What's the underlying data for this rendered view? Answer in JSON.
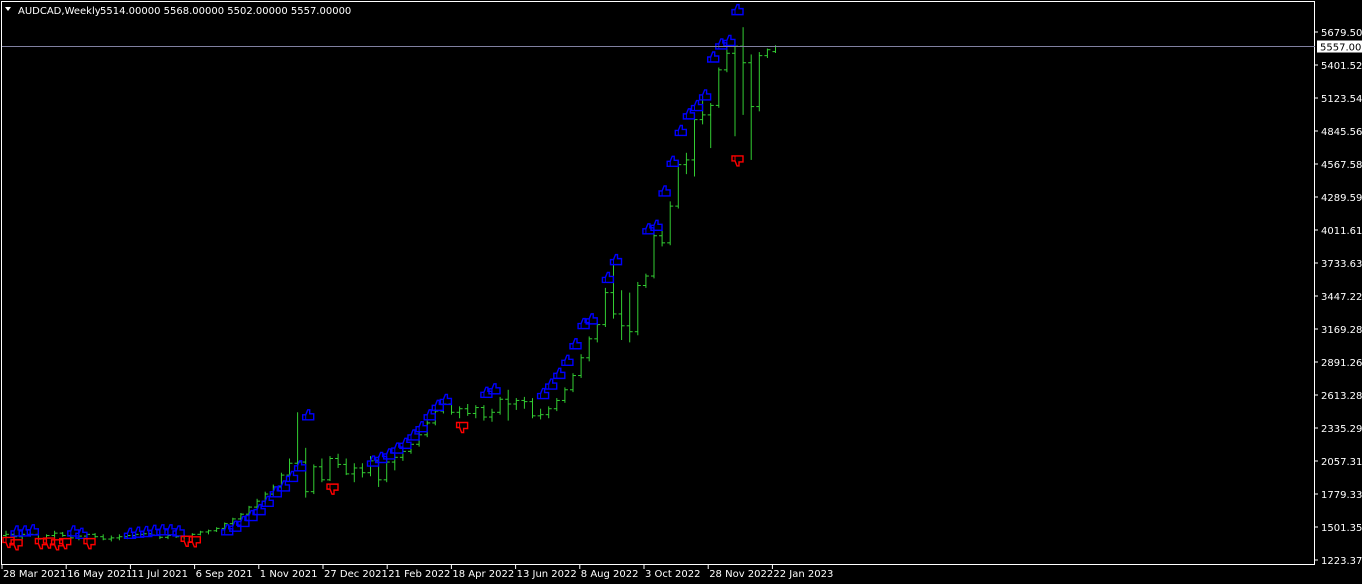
{
  "header": {
    "symbol_label": "AUDCAD,Weekly",
    "ohlc": "5514.00000 5568.00000 5502.00000 5557.00000"
  },
  "colors": {
    "background": "#000000",
    "bars": "#32CD32",
    "frame": "#ffffff",
    "bid_line": "#8080a0",
    "up_signal": "#0000ff",
    "down_signal": "#ff0000",
    "text": "#ffffff"
  },
  "chart_data": {
    "type": "ohlc-bar",
    "title": "AUDCAD,Weekly",
    "timeframe": "Weekly",
    "current_price": 5557.0,
    "current_price_label": "5557.0000",
    "ylim": [
      1223.3713,
      5679.5084
    ],
    "y_ticks": [
      "5679.5084",
      "5401.5263",
      "5123.5442",
      "4845.5621",
      "4567.5800",
      "4289.5979",
      "4011.6158",
      "3733.6337",
      "3447.2279",
      "3169.2816",
      "2891.2637",
      "2613.2816",
      "2335.2995",
      "2057.3174",
      "1779.3353",
      "1501.3532",
      "1223.3713"
    ],
    "x_ticks": [
      "28 Mar 2021",
      "16 May 2021",
      "11 Jul 2021",
      "6 Sep 2021",
      "1 Nov 2021",
      "27 Dec 2021",
      "21 Feb 2022",
      "18 Apr 2022",
      "13 Jun 2022",
      "8 Aug 2022",
      "3 Oct 2022",
      "28 Nov 2022",
      "22 Jan 2023"
    ],
    "bars": [
      {
        "o": 1430,
        "h": 1470,
        "l": 1395,
        "c": 1440
      },
      {
        "o": 1440,
        "h": 1450,
        "l": 1390,
        "c": 1420
      },
      {
        "o": 1420,
        "h": 1460,
        "l": 1400,
        "c": 1440
      },
      {
        "o": 1440,
        "h": 1460,
        "l": 1420,
        "c": 1440
      },
      {
        "o": 1440,
        "h": 1450,
        "l": 1390,
        "c": 1400
      },
      {
        "o": 1400,
        "h": 1440,
        "l": 1390,
        "c": 1430
      },
      {
        "o": 1430,
        "h": 1470,
        "l": 1410,
        "c": 1450
      },
      {
        "o": 1450,
        "h": 1460,
        "l": 1420,
        "c": 1430
      },
      {
        "o": 1430,
        "h": 1440,
        "l": 1395,
        "c": 1410
      },
      {
        "o": 1410,
        "h": 1440,
        "l": 1390,
        "c": 1425
      },
      {
        "o": 1425,
        "h": 1450,
        "l": 1410,
        "c": 1440
      },
      {
        "o": 1440,
        "h": 1450,
        "l": 1410,
        "c": 1420
      },
      {
        "o": 1420,
        "h": 1440,
        "l": 1390,
        "c": 1400
      },
      {
        "o": 1400,
        "h": 1430,
        "l": 1380,
        "c": 1410
      },
      {
        "o": 1410,
        "h": 1440,
        "l": 1390,
        "c": 1420
      },
      {
        "o": 1420,
        "h": 1450,
        "l": 1400,
        "c": 1430
      },
      {
        "o": 1430,
        "h": 1450,
        "l": 1410,
        "c": 1440
      },
      {
        "o": 1440,
        "h": 1460,
        "l": 1420,
        "c": 1445
      },
      {
        "o": 1445,
        "h": 1460,
        "l": 1420,
        "c": 1435
      },
      {
        "o": 1435,
        "h": 1450,
        "l": 1400,
        "c": 1415
      },
      {
        "o": 1415,
        "h": 1445,
        "l": 1400,
        "c": 1430
      },
      {
        "o": 1430,
        "h": 1450,
        "l": 1410,
        "c": 1420
      },
      {
        "o": 1420,
        "h": 1440,
        "l": 1400,
        "c": 1425
      },
      {
        "o": 1425,
        "h": 1450,
        "l": 1410,
        "c": 1440
      },
      {
        "o": 1440,
        "h": 1470,
        "l": 1430,
        "c": 1460
      },
      {
        "o": 1460,
        "h": 1480,
        "l": 1440,
        "c": 1470
      },
      {
        "o": 1470,
        "h": 1500,
        "l": 1460,
        "c": 1490
      },
      {
        "o": 1490,
        "h": 1540,
        "l": 1480,
        "c": 1530
      },
      {
        "o": 1530,
        "h": 1580,
        "l": 1510,
        "c": 1570
      },
      {
        "o": 1570,
        "h": 1620,
        "l": 1550,
        "c": 1610
      },
      {
        "o": 1610,
        "h": 1680,
        "l": 1590,
        "c": 1670
      },
      {
        "o": 1670,
        "h": 1740,
        "l": 1650,
        "c": 1720
      },
      {
        "o": 1720,
        "h": 1800,
        "l": 1700,
        "c": 1780
      },
      {
        "o": 1780,
        "h": 1860,
        "l": 1760,
        "c": 1840
      },
      {
        "o": 1840,
        "h": 1960,
        "l": 1820,
        "c": 1940
      },
      {
        "o": 1940,
        "h": 2080,
        "l": 1920,
        "c": 2040
      },
      {
        "o": 2040,
        "h": 2470,
        "l": 1990,
        "c": 2050
      },
      {
        "o": 2050,
        "h": 2170,
        "l": 1750,
        "c": 1800
      },
      {
        "o": 1800,
        "h": 2030,
        "l": 1780,
        "c": 2010
      },
      {
        "o": 2010,
        "h": 2080,
        "l": 1880,
        "c": 1900
      },
      {
        "o": 1900,
        "h": 2100,
        "l": 1890,
        "c": 2080
      },
      {
        "o": 2080,
        "h": 2120,
        "l": 2000,
        "c": 2030
      },
      {
        "o": 2030,
        "h": 2080,
        "l": 1940,
        "c": 1950
      },
      {
        "o": 1950,
        "h": 2040,
        "l": 1880,
        "c": 2000
      },
      {
        "o": 2000,
        "h": 2040,
        "l": 1920,
        "c": 1960
      },
      {
        "o": 1960,
        "h": 2100,
        "l": 1930,
        "c": 2060
      },
      {
        "o": 2060,
        "h": 2100,
        "l": 1840,
        "c": 1900
      },
      {
        "o": 1900,
        "h": 2080,
        "l": 1880,
        "c": 2050
      },
      {
        "o": 2050,
        "h": 2110,
        "l": 1980,
        "c": 2090
      },
      {
        "o": 2090,
        "h": 2160,
        "l": 2060,
        "c": 2140
      },
      {
        "o": 2140,
        "h": 2220,
        "l": 2120,
        "c": 2200
      },
      {
        "o": 2200,
        "h": 2300,
        "l": 2180,
        "c": 2280
      },
      {
        "o": 2280,
        "h": 2400,
        "l": 2260,
        "c": 2380
      },
      {
        "o": 2380,
        "h": 2500,
        "l": 2360,
        "c": 2480
      },
      {
        "o": 2480,
        "h": 2570,
        "l": 2460,
        "c": 2540
      },
      {
        "o": 2540,
        "h": 2560,
        "l": 2450,
        "c": 2470
      },
      {
        "o": 2470,
        "h": 2520,
        "l": 2420,
        "c": 2500
      },
      {
        "o": 2500,
        "h": 2540,
        "l": 2440,
        "c": 2460
      },
      {
        "o": 2460,
        "h": 2530,
        "l": 2420,
        "c": 2510
      },
      {
        "o": 2510,
        "h": 2530,
        "l": 2400,
        "c": 2430
      },
      {
        "o": 2430,
        "h": 2500,
        "l": 2390,
        "c": 2470
      },
      {
        "o": 2470,
        "h": 2600,
        "l": 2450,
        "c": 2580
      },
      {
        "o": 2580,
        "h": 2660,
        "l": 2400,
        "c": 2540
      },
      {
        "o": 2540,
        "h": 2590,
        "l": 2490,
        "c": 2570
      },
      {
        "o": 2570,
        "h": 2600,
        "l": 2500,
        "c": 2560
      },
      {
        "o": 2560,
        "h": 2590,
        "l": 2420,
        "c": 2440
      },
      {
        "o": 2440,
        "h": 2500,
        "l": 2410,
        "c": 2450
      },
      {
        "o": 2450,
        "h": 2520,
        "l": 2420,
        "c": 2500
      },
      {
        "o": 2500,
        "h": 2590,
        "l": 2480,
        "c": 2570
      },
      {
        "o": 2570,
        "h": 2680,
        "l": 2550,
        "c": 2660
      },
      {
        "o": 2660,
        "h": 2800,
        "l": 2640,
        "c": 2780
      },
      {
        "o": 2780,
        "h": 2960,
        "l": 2760,
        "c": 2930
      },
      {
        "o": 2930,
        "h": 3110,
        "l": 2900,
        "c": 3090
      },
      {
        "o": 3090,
        "h": 3230,
        "l": 3060,
        "c": 3210
      },
      {
        "o": 3210,
        "h": 3520,
        "l": 3190,
        "c": 3480
      },
      {
        "o": 3480,
        "h": 3720,
        "l": 3260,
        "c": 3300
      },
      {
        "o": 3300,
        "h": 3500,
        "l": 3080,
        "c": 3200
      },
      {
        "o": 3200,
        "h": 3480,
        "l": 3060,
        "c": 3150
      },
      {
        "o": 3150,
        "h": 3570,
        "l": 3120,
        "c": 3540
      },
      {
        "o": 3540,
        "h": 3640,
        "l": 3520,
        "c": 3620
      },
      {
        "o": 3620,
        "h": 4000,
        "l": 3600,
        "c": 3960
      },
      {
        "o": 3960,
        "h": 4000,
        "l": 3870,
        "c": 3900
      },
      {
        "o": 3900,
        "h": 4250,
        "l": 3880,
        "c": 4210
      },
      {
        "o": 4210,
        "h": 4590,
        "l": 4190,
        "c": 4560
      },
      {
        "o": 4560,
        "h": 4660,
        "l": 4480,
        "c": 4600
      },
      {
        "o": 4600,
        "h": 4960,
        "l": 4460,
        "c": 4940
      },
      {
        "o": 4940,
        "h": 5140,
        "l": 4900,
        "c": 4980
      },
      {
        "o": 4980,
        "h": 5080,
        "l": 4700,
        "c": 5060
      },
      {
        "o": 5060,
        "h": 5380,
        "l": 5040,
        "c": 5360
      },
      {
        "o": 5360,
        "h": 5560,
        "l": 5340,
        "c": 5500
      },
      {
        "o": 5500,
        "h": 5580,
        "l": 4800,
        "c": 5560
      },
      {
        "o": 5560,
        "h": 5720,
        "l": 4980,
        "c": 5420
      },
      {
        "o": 5420,
        "h": 5490,
        "l": 4600,
        "c": 5050
      },
      {
        "o": 5050,
        "h": 5510,
        "l": 5010,
        "c": 5480
      },
      {
        "o": 5480,
        "h": 5540,
        "l": 5460,
        "c": 5530
      },
      {
        "o": 5514,
        "h": 5568,
        "l": 5502,
        "c": 5557
      }
    ],
    "up_signals": [
      {
        "i": 1,
        "v": 1460
      },
      {
        "i": 2,
        "v": 1460
      },
      {
        "i": 3,
        "v": 1470
      },
      {
        "i": 8,
        "v": 1460
      },
      {
        "i": 9,
        "v": 1440
      },
      {
        "i": 15,
        "v": 1440
      },
      {
        "i": 16,
        "v": 1450
      },
      {
        "i": 17,
        "v": 1455
      },
      {
        "i": 18,
        "v": 1465
      },
      {
        "i": 19,
        "v": 1470
      },
      {
        "i": 20,
        "v": 1470
      },
      {
        "i": 21,
        "v": 1460
      },
      {
        "i": 27,
        "v": 1470
      },
      {
        "i": 28,
        "v": 1500
      },
      {
        "i": 29,
        "v": 1540
      },
      {
        "i": 30,
        "v": 1590
      },
      {
        "i": 31,
        "v": 1640
      },
      {
        "i": 32,
        "v": 1710
      },
      {
        "i": 33,
        "v": 1790
      },
      {
        "i": 34,
        "v": 1840
      },
      {
        "i": 35,
        "v": 1920
      },
      {
        "i": 36,
        "v": 2010
      },
      {
        "i": 37,
        "v": 2440
      },
      {
        "i": 45,
        "v": 2050
      },
      {
        "i": 46,
        "v": 2080
      },
      {
        "i": 47,
        "v": 2110
      },
      {
        "i": 48,
        "v": 2160
      },
      {
        "i": 49,
        "v": 2200
      },
      {
        "i": 50,
        "v": 2270
      },
      {
        "i": 51,
        "v": 2340
      },
      {
        "i": 52,
        "v": 2440
      },
      {
        "i": 53,
        "v": 2520
      },
      {
        "i": 54,
        "v": 2570
      },
      {
        "i": 59,
        "v": 2630
      },
      {
        "i": 60,
        "v": 2660
      },
      {
        "i": 66,
        "v": 2620
      },
      {
        "i": 67,
        "v": 2700
      },
      {
        "i": 68,
        "v": 2790
      },
      {
        "i": 69,
        "v": 2900
      },
      {
        "i": 70,
        "v": 3040
      },
      {
        "i": 71,
        "v": 3210
      },
      {
        "i": 72,
        "v": 3250
      },
      {
        "i": 74,
        "v": 3600
      },
      {
        "i": 75,
        "v": 3750
      },
      {
        "i": 79,
        "v": 4010
      },
      {
        "i": 80,
        "v": 4040
      },
      {
        "i": 81,
        "v": 4330
      },
      {
        "i": 82,
        "v": 4580
      },
      {
        "i": 83,
        "v": 4840
      },
      {
        "i": 84,
        "v": 4980
      },
      {
        "i": 85,
        "v": 5050
      },
      {
        "i": 86,
        "v": 5140
      },
      {
        "i": 87,
        "v": 5460
      },
      {
        "i": 88,
        "v": 5570
      },
      {
        "i": 89,
        "v": 5600
      },
      {
        "i": 90,
        "v": 5860
      }
    ],
    "down_signals": [
      {
        "i": 0,
        "v": 1380
      },
      {
        "i": 1,
        "v": 1360
      },
      {
        "i": 4,
        "v": 1370
      },
      {
        "i": 5,
        "v": 1375
      },
      {
        "i": 6,
        "v": 1360
      },
      {
        "i": 7,
        "v": 1370
      },
      {
        "i": 10,
        "v": 1370
      },
      {
        "i": 22,
        "v": 1390
      },
      {
        "i": 23,
        "v": 1385
      },
      {
        "i": 40,
        "v": 1830
      },
      {
        "i": 56,
        "v": 2350
      },
      {
        "i": 90,
        "v": 4600
      }
    ]
  }
}
